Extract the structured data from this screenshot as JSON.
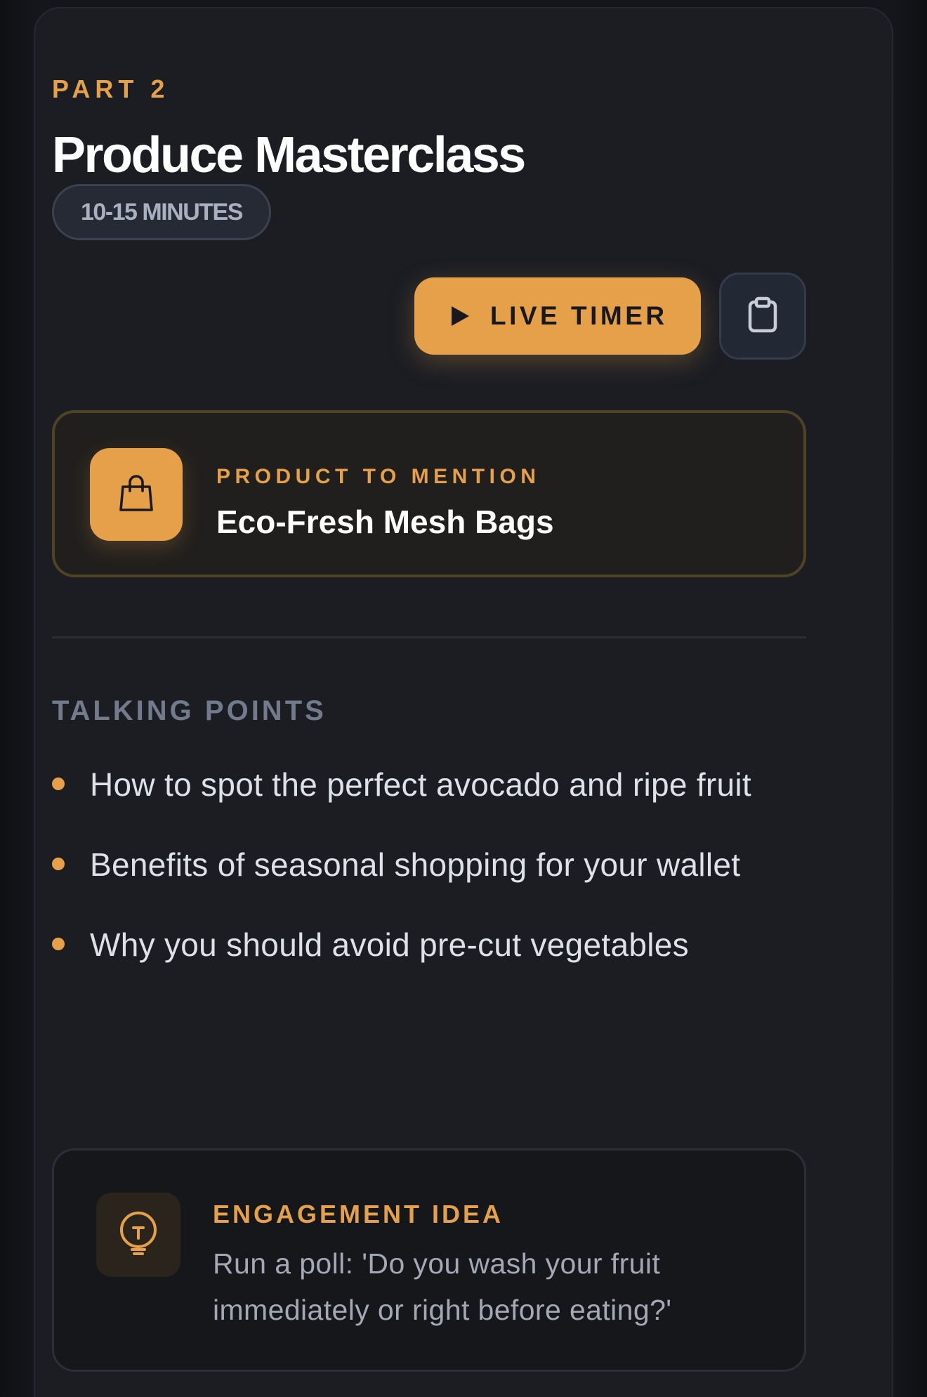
{
  "segment": {
    "part_label": "PART 2",
    "title": "Produce Masterclass",
    "duration": "10-15 MINUTES"
  },
  "actions": {
    "live_timer_label": "LIVE TIMER",
    "play_icon": "play-icon",
    "clipboard_icon": "clipboard-icon"
  },
  "product": {
    "eyebrow": "PRODUCT TO MENTION",
    "name": "Eco-Fresh Mesh Bags",
    "icon": "shopping-bag-icon"
  },
  "talking_points": {
    "title": "TALKING POINTS",
    "items": [
      "How to spot the perfect avocado and ripe fruit",
      "Benefits of seasonal shopping for your wallet",
      "Why you should avoid pre-cut vegetables"
    ]
  },
  "engagement": {
    "title": "ENGAGEMENT IDEA",
    "text": "Run a poll: 'Do you wash your fruit immediately or right before eating?'",
    "icon": "lightbulb-icon"
  },
  "colors": {
    "accent": "#e6a04a",
    "background": "#1b1d23",
    "text_primary": "#ffffff",
    "text_muted": "#727b8c"
  }
}
